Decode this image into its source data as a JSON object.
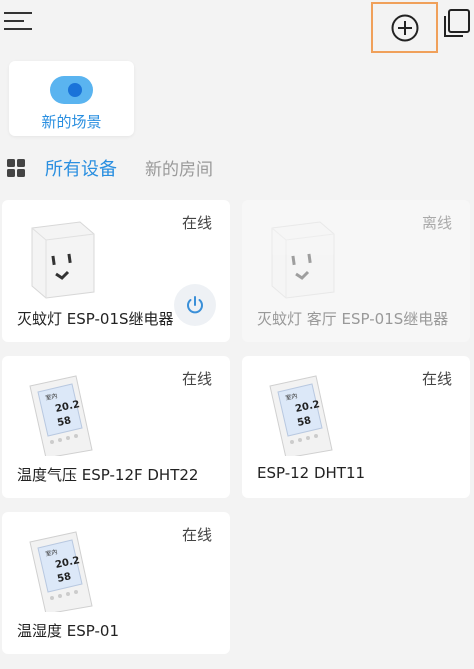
{
  "header": {
    "menu_icon": "hamburger-menu-icon",
    "add_icon": "add-circle-icon",
    "copy_icon": "copy-icon",
    "highlight_color": "#f0a05a"
  },
  "scene": {
    "label": "新的场景",
    "toggle_color": "#5ab4f0",
    "accent_color": "#2a8fe0"
  },
  "tabs": {
    "active": "所有设备",
    "inactive": "新的房间",
    "grid_icon": "grid-icon"
  },
  "devices": [
    {
      "name": "灭蚊灯 ESP-01S继电器",
      "status": "在线",
      "type": "smart-plug",
      "has_power": true
    },
    {
      "name": "灭蚊灯 客厅 ESP-01S继电器",
      "status": "离线",
      "type": "smart-plug",
      "has_power": false
    },
    {
      "name": "温度气压 ESP-12F DHT22",
      "status": "在线",
      "type": "thermostat",
      "has_power": false
    },
    {
      "name": "ESP-12 DHT11",
      "status": "在线",
      "type": "thermostat",
      "has_power": false
    },
    {
      "name": "温湿度 ESP-01",
      "status": "在线",
      "type": "thermostat",
      "has_power": false
    }
  ],
  "thermostat_display": {
    "temp": "20.2",
    "hum": "58"
  }
}
